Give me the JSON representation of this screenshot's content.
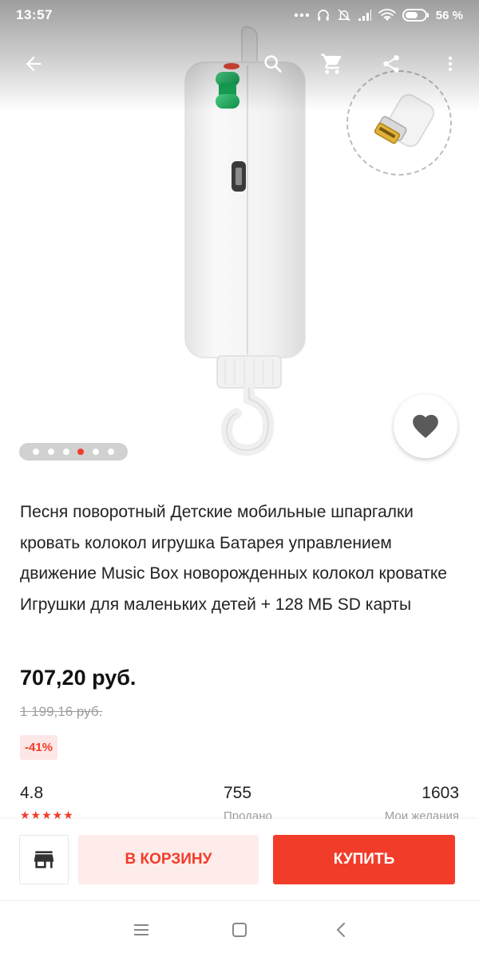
{
  "status_bar": {
    "time": "13:57",
    "battery": "56 %",
    "icons": [
      "dots-icon",
      "headphones-icon",
      "bell-muted-icon",
      "signal-icon",
      "wifi-icon",
      "battery-icon"
    ]
  },
  "toolbar": {
    "icons": [
      "back-arrow-icon",
      "search-icon",
      "cart-icon",
      "share-icon",
      "more-vert-icon"
    ]
  },
  "gallery": {
    "image_count": 6,
    "active_index": 3
  },
  "product": {
    "title": "Песня поворотный Детские мобильные шпаргалки кровать колокол игрушка Батарея управлением движение Music Box новорожденных колокол кроватке Игрушки для маленьких детей + 128 МБ SD карты",
    "price": "707,20 руб.",
    "old_price": "1 199,16 руб.",
    "discount": "-41%"
  },
  "stats": {
    "rating": {
      "value": "4.8",
      "stars": "★★★★★"
    },
    "sold": {
      "value": "755",
      "label": "Продано"
    },
    "wishes": {
      "value": "1603",
      "label": "Мои желания"
    }
  },
  "actions": {
    "cart_label": "В КОРЗИНУ",
    "buy_label": "КУПИТЬ"
  },
  "colors": {
    "accent": "#f23c2a",
    "accent_light": "#fdecea",
    "text": "#222222",
    "muted": "#9e9e9e"
  }
}
